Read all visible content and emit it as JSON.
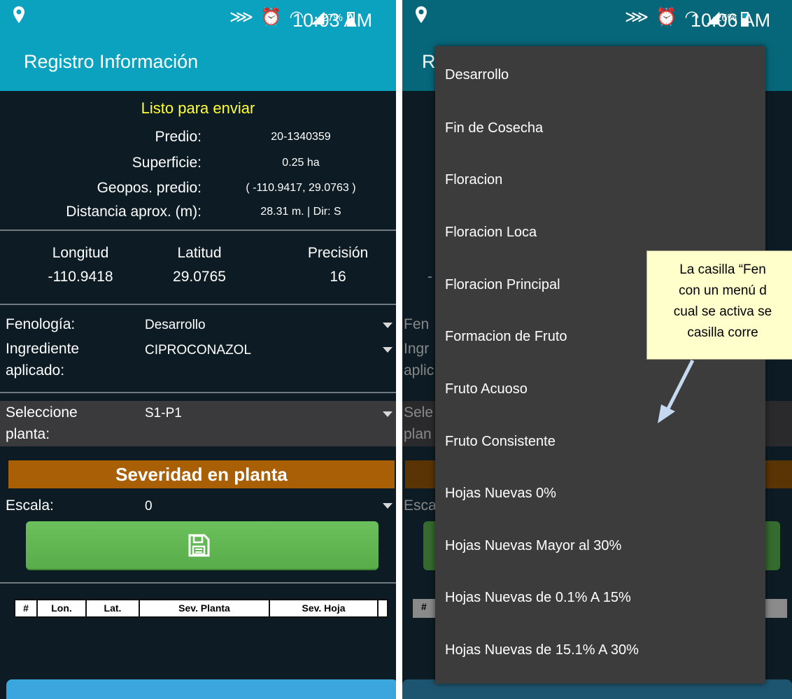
{
  "left": {
    "status": {
      "battery": "27%",
      "time": "10:03 AM"
    },
    "app_title": "Registro Información",
    "ready_text": "Listo para enviar",
    "info": [
      {
        "label": "Predio:",
        "value": "20-1340359"
      },
      {
        "label": "Superficie:",
        "value": "0.25 ha"
      },
      {
        "label": "Geopos. predio:",
        "value": "( -110.9417, 29.0763 )"
      },
      {
        "label": "Distancia aprox. (m):",
        "value": "28.31 m. | Dir: S"
      }
    ],
    "gps": {
      "longitud": {
        "label": "Longitud",
        "value": "-110.9418"
      },
      "latitud": {
        "label": "Latitud",
        "value": "29.0765"
      },
      "precision": {
        "label": "Precisión",
        "value": "16"
      }
    },
    "fenologia": {
      "label": "Fenología:",
      "value": "Desarrollo"
    },
    "ingrediente": {
      "label_line1": "Ingrediente",
      "label_line2": "aplicado:",
      "value": "CIPROCONAZOL"
    },
    "planta": {
      "label_line1": "Seleccione",
      "label_line2": "planta:",
      "value": "S1-P1"
    },
    "severidad_header": "Severidad en planta",
    "escala": {
      "label": "Escala:",
      "value": "0"
    },
    "table_headers": [
      "#",
      "Lon.",
      "Lat.",
      "Sev. Planta",
      "Sev. Hoja",
      ""
    ]
  },
  "right": {
    "status": {
      "battery": "26%",
      "time": "10:06 AM"
    },
    "bg_peek": {
      "title_initial": "R",
      "fen": "Fen",
      "ingr1": "Ingr",
      "ingr2": "aplic",
      "sele1": "Sele",
      "sele2": "plan",
      "esca": "Esca",
      "hash": "#",
      "minus": "-"
    },
    "menu_items": [
      "Desarrollo",
      "Fin de Cosecha",
      "Floracion",
      "Floracion Loca",
      "Floracion Principal",
      "Formacion de Fruto",
      "Fruto Acuoso",
      "Fruto Consistente",
      "Hojas Nuevas 0%",
      "Hojas Nuevas Mayor al 30%",
      "Hojas Nuevas de 0.1% A 15%",
      "Hojas Nuevas de 15.1% A 30%"
    ],
    "callout_lines": [
      "La casilla “Fen",
      "con un menú d",
      "cual se activa se",
      "casilla corre"
    ]
  },
  "colors": {
    "app_bar": "#0aa2bf",
    "screen_bg": "#0d1c24",
    "ready_text": "#ffff33",
    "severity_header": "#a95f05",
    "save_button": "#5cb24e",
    "menu_bg": "#3c3c3c",
    "callout_bg": "#ffffcc",
    "arrow": "#c5d9f1"
  }
}
